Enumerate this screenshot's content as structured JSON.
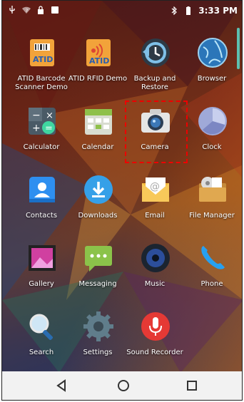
{
  "status_bar": {
    "time": "3:33 PM",
    "left_icons": [
      "usb-icon",
      "wifi-question-icon",
      "lock-icon",
      "image-icon"
    ],
    "right_icons": [
      "bluetooth-icon",
      "battery-icon"
    ]
  },
  "apps": [
    {
      "id": "atid-barcode",
      "label": "ATID Barcode\nScanner Demo",
      "icon": "atid-barcode-icon"
    },
    {
      "id": "atid-rfid",
      "label": "ATID RFID Demo",
      "icon": "atid-rfid-icon"
    },
    {
      "id": "backup-restore",
      "label": "Backup and\nRestore",
      "icon": "backup-restore-icon"
    },
    {
      "id": "browser",
      "label": "Browser",
      "icon": "globe-icon"
    },
    {
      "id": "calculator",
      "label": "Calculator",
      "icon": "calculator-icon"
    },
    {
      "id": "calendar",
      "label": "Calendar",
      "icon": "calendar-icon"
    },
    {
      "id": "camera",
      "label": "Camera",
      "icon": "camera-icon"
    },
    {
      "id": "clock",
      "label": "Clock",
      "icon": "clock-icon"
    },
    {
      "id": "contacts",
      "label": "Contacts",
      "icon": "contacts-icon"
    },
    {
      "id": "downloads",
      "label": "Downloads",
      "icon": "download-icon"
    },
    {
      "id": "email",
      "label": "Email",
      "icon": "email-icon"
    },
    {
      "id": "file-manager",
      "label": "File Manager",
      "icon": "file-manager-icon"
    },
    {
      "id": "gallery",
      "label": "Gallery",
      "icon": "gallery-icon"
    },
    {
      "id": "messaging",
      "label": "Messaging",
      "icon": "messaging-icon"
    },
    {
      "id": "music",
      "label": "Music",
      "icon": "music-icon"
    },
    {
      "id": "phone",
      "label": "Phone",
      "icon": "phone-icon"
    },
    {
      "id": "search",
      "label": "Search",
      "icon": "search-icon"
    },
    {
      "id": "settings",
      "label": "Settings",
      "icon": "gear-icon"
    },
    {
      "id": "sound-recorder",
      "label": "Sound Recorder",
      "icon": "microphone-icon"
    }
  ],
  "highlighted_app": "camera",
  "nav_bar": {
    "buttons": [
      "back-icon",
      "home-icon",
      "recents-icon"
    ]
  },
  "colors": {
    "highlight": "#e00000",
    "accent": "#5bd0c0"
  }
}
